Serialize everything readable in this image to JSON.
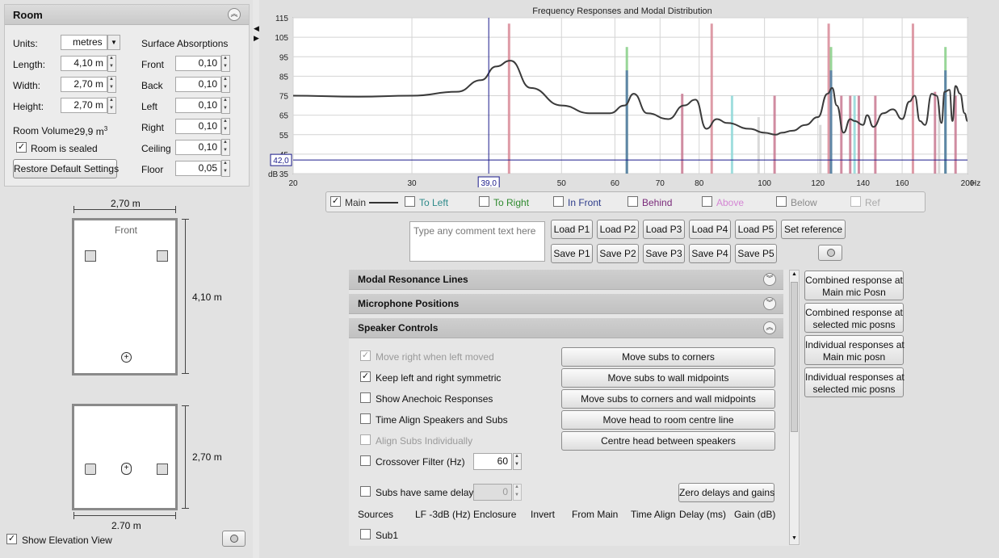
{
  "room": {
    "title": "Room",
    "units_label": "Units:",
    "units_value": "metres",
    "length_label": "Length:",
    "length_value": "4,10 m",
    "width_label": "Width:",
    "width_value": "2,70 m",
    "height_label": "Height:",
    "height_value": "2,70 m",
    "volume_label": "Room Volume:",
    "volume_value": "29,9 m",
    "volume_exp": "3",
    "sealed_label": "Room is sealed",
    "restore_label": "Restore Default Settings",
    "absorb_title": "Surface Absorptions",
    "surfaces": [
      {
        "label": "Front",
        "value": "0,10"
      },
      {
        "label": "Back",
        "value": "0,10"
      },
      {
        "label": "Left",
        "value": "0,10"
      },
      {
        "label": "Right",
        "value": "0,10"
      },
      {
        "label": "Ceiling",
        "value": "0,10"
      },
      {
        "label": "Floor",
        "value": "0,05"
      }
    ]
  },
  "plan": {
    "top_width": "2,70 m",
    "front_label": "Front",
    "length": "4,10 m",
    "elev_height": "2,70 m",
    "elev_width": "2.70 m",
    "show_elevation_label": "Show Elevation View"
  },
  "chart_data": {
    "type": "line",
    "title": "Frequency Responses and Modal Distribution",
    "x_unit": "Hz",
    "x_scale": "log",
    "xlim": [
      20,
      200
    ],
    "ylim": [
      35,
      115
    ],
    "ylabel": "dB",
    "x_ticks": [
      "20",
      "30",
      "39,0",
      "50",
      "60",
      "70",
      "80",
      "100",
      "120",
      "140",
      "160",
      "200"
    ],
    "y_ticks": [
      "115",
      "105",
      "95",
      "85",
      "75",
      "65",
      "55",
      "45",
      "35"
    ],
    "cursor_x": "39,0",
    "cursor_y": "42,0",
    "series": [
      {
        "name": "Main",
        "color": "#3a3a3a",
        "x": [
          20,
          25,
          30,
          35,
          38,
          40,
          42,
          45,
          50,
          55,
          59,
          62,
          64,
          67,
          72,
          76,
          79,
          82,
          85,
          88,
          95,
          100,
          104,
          106,
          110,
          115,
          120,
          124,
          126,
          128,
          131,
          134,
          136,
          140,
          142,
          145,
          150,
          155,
          160,
          164,
          167,
          170,
          173,
          177,
          180,
          183,
          185,
          188,
          190,
          192,
          195,
          198,
          200
        ],
        "y": [
          75,
          74.5,
          75,
          77,
          83,
          90,
          93,
          79,
          70,
          66,
          66,
          70,
          76,
          66,
          63,
          70,
          73,
          58,
          63,
          61,
          58,
          56,
          55,
          56,
          57,
          60,
          64,
          76,
          79,
          70,
          56,
          63,
          62,
          60,
          65,
          59,
          66,
          68,
          63,
          72,
          75,
          62,
          60,
          76,
          75,
          61,
          77,
          78,
          62,
          80,
          76,
          66,
          62
        ]
      }
    ],
    "modal_lines": [
      {
        "f": 41.8,
        "top": 112,
        "color": "#d88a98"
      },
      {
        "f": 62.5,
        "top": 100,
        "color": "#86cf86"
      },
      {
        "f": 62.5,
        "top": 88,
        "color": "#5478a8"
      },
      {
        "f": 75.5,
        "top": 76,
        "color": "#c87890"
      },
      {
        "f": 83.5,
        "top": 112,
        "color": "#d88a98"
      },
      {
        "f": 89.5,
        "top": 75,
        "color": "#8fd8d8"
      },
      {
        "f": 98.0,
        "top": 64,
        "color": "#d2d2d2"
      },
      {
        "f": 103.5,
        "top": 75,
        "color": "#c87890"
      },
      {
        "f": 121.0,
        "top": 60,
        "color": "#d2d2d2"
      },
      {
        "f": 124.5,
        "top": 112,
        "color": "#d88a98"
      },
      {
        "f": 125.5,
        "top": 100,
        "color": "#86cf86"
      },
      {
        "f": 125.5,
        "top": 88,
        "color": "#5478a8"
      },
      {
        "f": 130.0,
        "top": 75,
        "color": "#c87890"
      },
      {
        "f": 134.0,
        "top": 75,
        "color": "#c87890"
      },
      {
        "f": 136.0,
        "top": 75,
        "color": "#8fd8d8"
      },
      {
        "f": 138.0,
        "top": 75,
        "color": "#c87890"
      },
      {
        "f": 146.0,
        "top": 75,
        "color": "#c87890"
      },
      {
        "f": 166.0,
        "top": 112,
        "color": "#d88a98"
      },
      {
        "f": 179.0,
        "top": 77,
        "color": "#c87890"
      },
      {
        "f": 181.5,
        "top": 70,
        "color": "#d2d2d2"
      },
      {
        "f": 185.5,
        "top": 100,
        "color": "#86cf86"
      },
      {
        "f": 185.5,
        "top": 88,
        "color": "#5478a8"
      },
      {
        "f": 192.0,
        "top": 75,
        "color": "#c87890"
      }
    ]
  },
  "legend": [
    {
      "label": "Main",
      "color": "#333333",
      "checked": true
    },
    {
      "label": "To Left",
      "color": "#2e8a8a",
      "checked": false
    },
    {
      "label": "To Right",
      "color": "#2e8a2e",
      "checked": false
    },
    {
      "label": "In Front",
      "color": "#2b3a8a",
      "checked": false
    },
    {
      "label": "Behind",
      "color": "#7a2a7a",
      "checked": false
    },
    {
      "label": "Above",
      "color": "#d486d4",
      "checked": false
    },
    {
      "label": "Below",
      "color": "#8a8a8a",
      "checked": false
    },
    {
      "label": "Ref",
      "color": "#aaaaaa",
      "checked": false
    }
  ],
  "comment": {
    "placeholder": "Type any comment text here"
  },
  "presets": {
    "load": [
      "Load P1",
      "Load P2",
      "Load P3",
      "Load P4",
      "Load P5"
    ],
    "save": [
      "Save P1",
      "Save P2",
      "Save P3",
      "Save P4",
      "Save P5"
    ],
    "set_reference": "Set reference"
  },
  "sections": {
    "modal": "Modal Resonance Lines",
    "mic": "Microphone Positions",
    "speaker": "Speaker Controls"
  },
  "speaker": {
    "options": [
      {
        "label": "Move right when left moved",
        "checked": true,
        "disabled": true
      },
      {
        "label": "Keep left and right symmetric",
        "checked": true,
        "disabled": false
      },
      {
        "label": "Show Anechoic Responses",
        "checked": false,
        "disabled": false
      },
      {
        "label": "Time Align Speakers and Subs",
        "checked": false,
        "disabled": false
      },
      {
        "label": "Align Subs Individually",
        "checked": false,
        "disabled": true
      },
      {
        "label": "Crossover Filter (Hz)",
        "checked": false,
        "disabled": false
      }
    ],
    "crossover_value": "60",
    "subs_delay_label": "Subs have same delay",
    "subs_delay_value": "0",
    "buttons": [
      "Move subs to corners",
      "Move subs to wall midpoints",
      "Move subs to corners and wall midpoints",
      "Move head to room centre line",
      "Centre head between speakers"
    ],
    "zero_label": "Zero delays and gains",
    "columns": [
      "Sources",
      "LF -3dB (Hz)",
      "Enclosure",
      "Invert",
      "From Main",
      "Time Align",
      "Delay (ms)",
      "Gain (dB)"
    ],
    "sub1_label": "Sub1"
  },
  "response_buttons": [
    {
      "l1": "Combined response at",
      "l2": "Main mic Posn"
    },
    {
      "l1": "Combined response at",
      "l2": "selected mic posns"
    },
    {
      "l1": "Individual responses at",
      "l2": "Main mic posn"
    },
    {
      "l1": "Individual responses at",
      "l2": "selected mic posns"
    }
  ]
}
